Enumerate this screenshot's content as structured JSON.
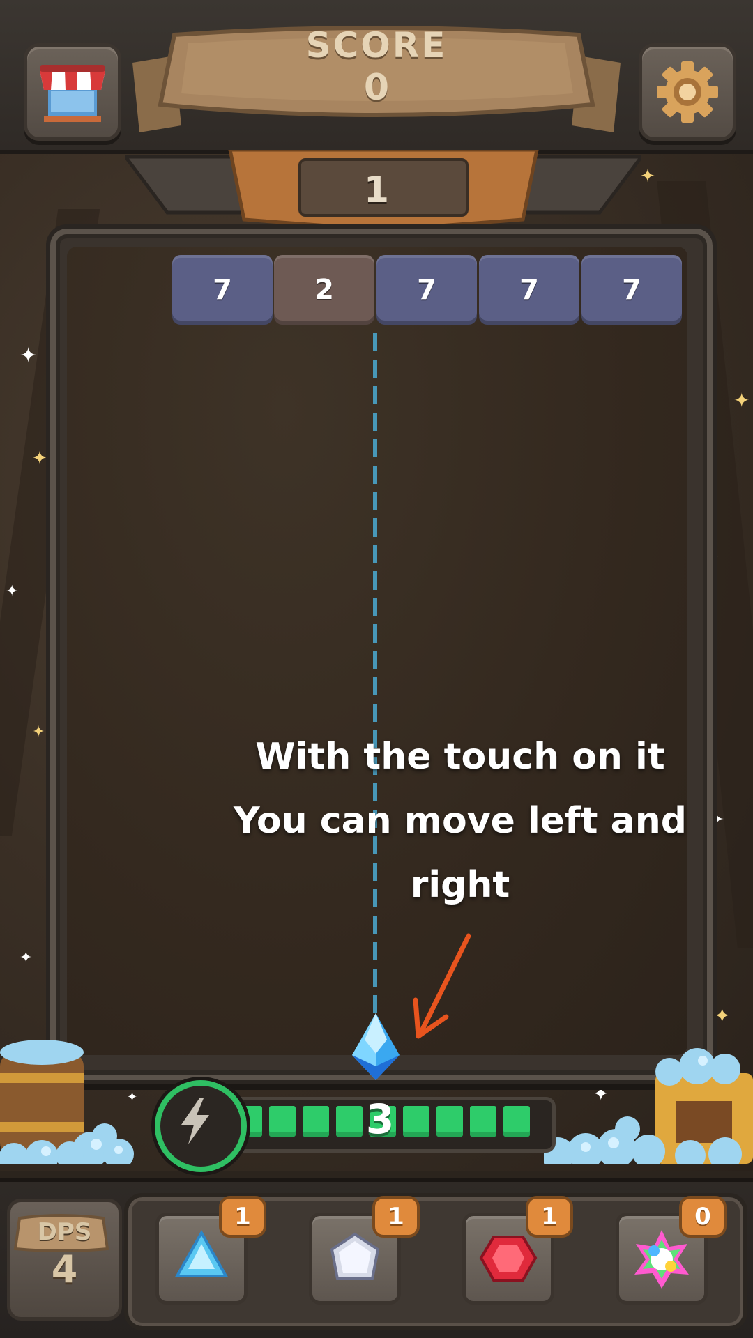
{
  "header": {
    "score_label": "SCORE",
    "score_value": "0",
    "level_value": "1"
  },
  "bricks": [
    "7",
    "2",
    "7",
    "7",
    "7"
  ],
  "brick_colors": [
    "#5b5f86",
    "#6e5a54",
    "#5b5f86",
    "#5b5f86",
    "#5b5f86"
  ],
  "tutorial": {
    "line1": "With the touch on it",
    "line2": "You can move left and",
    "line3": "right"
  },
  "power": {
    "value": "3",
    "segments_filled": 9
  },
  "dps": {
    "label": "DPS",
    "value": "4"
  },
  "items": [
    {
      "name": "blue-triangle-gem",
      "count": "1"
    },
    {
      "name": "white-diamond-gem",
      "count": "1"
    },
    {
      "name": "red-gem",
      "count": "1"
    },
    {
      "name": "rainbow-gem",
      "count": "0"
    }
  ],
  "colors": {
    "accent_green": "#2ecc6a",
    "badge_orange": "#e08a3c",
    "arrow": "#e8541e"
  }
}
